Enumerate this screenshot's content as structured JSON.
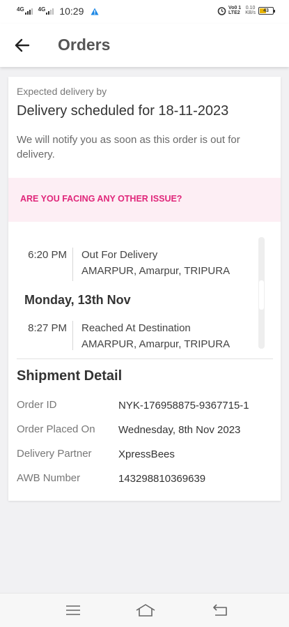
{
  "status_bar": {
    "sim1_label": "4G",
    "sim2_label": "4G",
    "time": "10:29",
    "volte_line1": "Vo0 1",
    "volte_line2": "LTE2",
    "speed_value": "0.10",
    "speed_unit": "KB/s",
    "battery_level": "43",
    "battery_color": "#e8b400"
  },
  "header": {
    "title": "Orders",
    "back_icon": "arrow-left-icon"
  },
  "delivery": {
    "label": "Expected delivery by",
    "scheduled": "Delivery scheduled for 18-11-2023",
    "note": "We will notify you as soon as this order is out for delivery."
  },
  "issue_banner": {
    "text": "ARE YOU FACING ANY OTHER ISSUE?",
    "text_color": "#e0267a",
    "background": "#fdeef4"
  },
  "timeline": {
    "entries": [
      {
        "time": "6:20 PM",
        "status": "Out For Delivery",
        "location": "AMARPUR, Amarpur, TRIPURA"
      },
      {
        "date_header": "Monday, 13th Nov"
      },
      {
        "time": "8:27 PM",
        "status": "Reached At Destination",
        "location": "AMARPUR, Amarpur, TRIPURA"
      }
    ]
  },
  "shipment": {
    "title": "Shipment Detail",
    "rows": [
      {
        "label": "Order ID",
        "value": "NYK-176958875-9367715-1"
      },
      {
        "label": "Order Placed On",
        "value": "Wednesday, 8th Nov 2023"
      },
      {
        "label": "Delivery Partner",
        "value": "XpressBees"
      },
      {
        "label": "AWB Number",
        "value": "143298810369639"
      }
    ]
  },
  "nav": {
    "icons": [
      "menu-icon",
      "home-icon",
      "back-nav-icon"
    ]
  }
}
